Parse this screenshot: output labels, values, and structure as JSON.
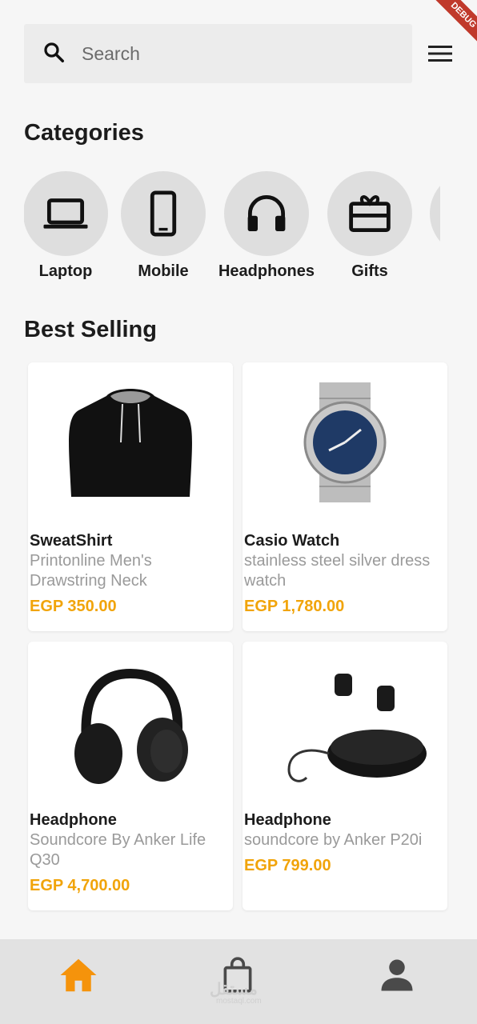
{
  "debug_banner": "DEBUG",
  "search": {
    "placeholder": "Search"
  },
  "categories": {
    "title": "Categories",
    "items": [
      {
        "label": "Laptop",
        "icon": "laptop-icon"
      },
      {
        "label": "Mobile",
        "icon": "mobile-icon"
      },
      {
        "label": "Headphones",
        "icon": "headphones-icon"
      },
      {
        "label": "Gifts",
        "icon": "gift-icon"
      }
    ]
  },
  "best_selling": {
    "title": "Best Selling",
    "products": [
      {
        "name": "SweatShirt",
        "description": "Printonline Men's Drawstring Neck",
        "price": "EGP 350.00",
        "image": "hoodie"
      },
      {
        "name": "Casio Watch",
        "description": "stainless steel silver dress watch",
        "price": "EGP 1,780.00",
        "image": "watch"
      },
      {
        "name": "Headphone",
        "description": "Soundcore By Anker Life Q30",
        "price": "EGP 4,700.00",
        "image": "headphones"
      },
      {
        "name": "Headphone",
        "description": "soundcore by Anker P20i",
        "price": "EGP 799.00",
        "image": "earbuds"
      }
    ]
  },
  "bottom_nav": {
    "items": [
      {
        "name": "home",
        "icon": "home-icon",
        "active": true
      },
      {
        "name": "cart",
        "icon": "shopping-bag-icon",
        "active": false
      },
      {
        "name": "profile",
        "icon": "person-icon",
        "active": false
      }
    ],
    "watermark": "مستقل",
    "watermark_sub": "mostaql.com"
  },
  "colors": {
    "accent": "#f1a40a",
    "active_nav": "#f5930b",
    "inactive_nav": "#4a4a4a",
    "circle": "#dedede"
  }
}
